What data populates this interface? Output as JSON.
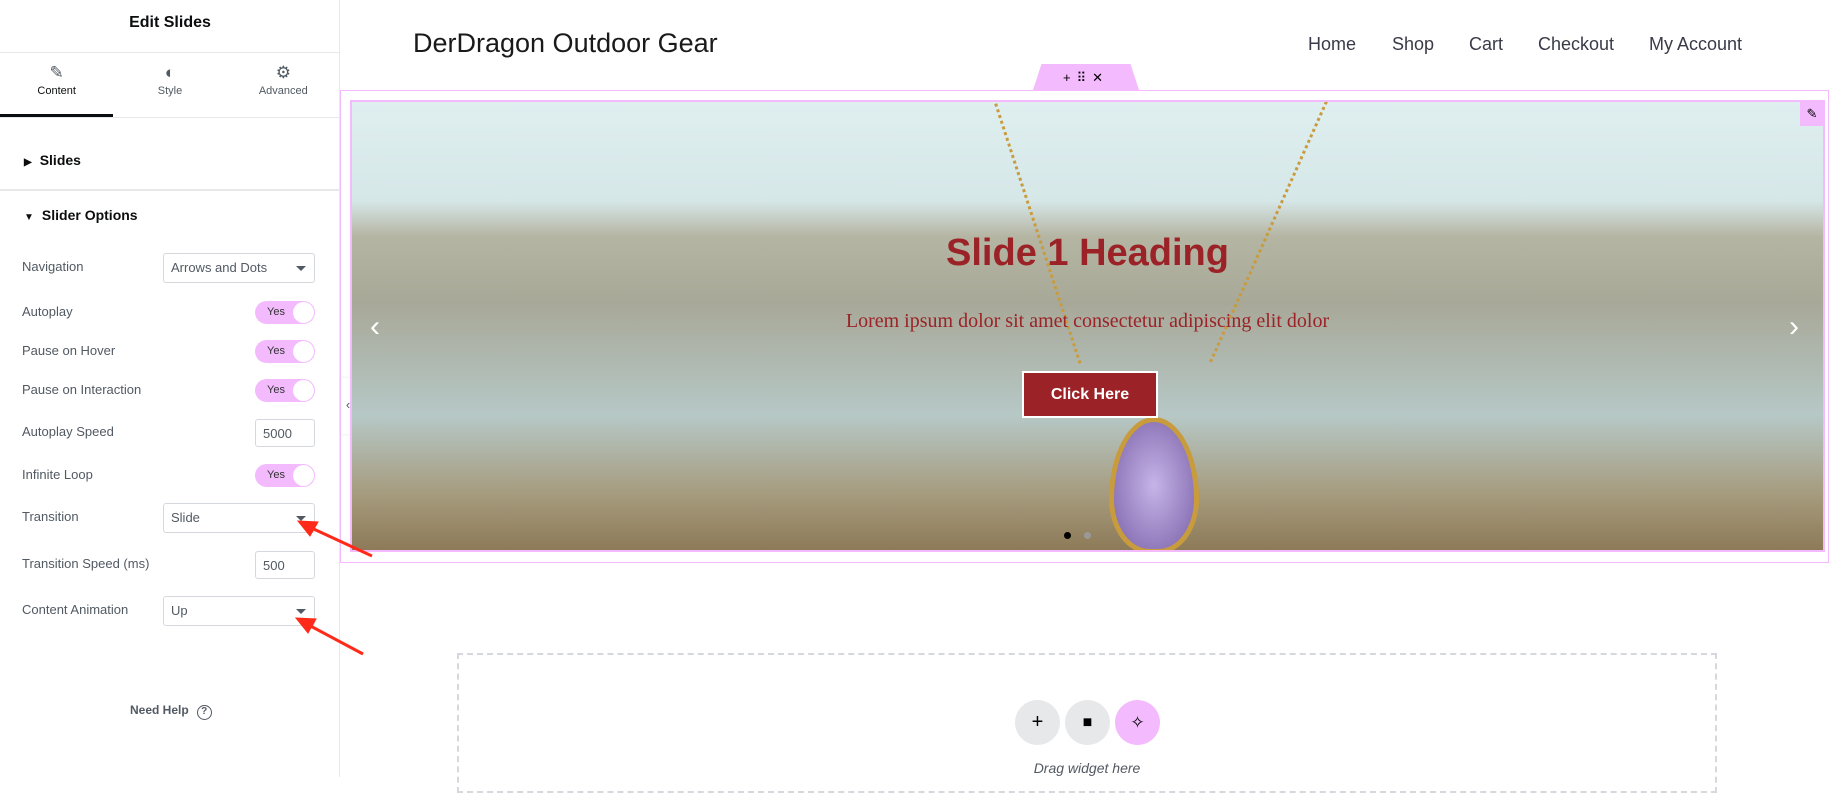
{
  "panel": {
    "title": "Edit Slides",
    "tabs": [
      {
        "label": "Content",
        "icon": "pencil-icon"
      },
      {
        "label": "Style",
        "icon": "contrast-icon"
      },
      {
        "label": "Advanced",
        "icon": "gear-icon"
      }
    ],
    "sections": {
      "slides": "Slides",
      "slider_options": "Slider Options"
    },
    "controls": {
      "navigation": {
        "label": "Navigation",
        "value": "Arrows and Dots"
      },
      "autoplay": {
        "label": "Autoplay",
        "value": "Yes"
      },
      "pause_hover": {
        "label": "Pause on Hover",
        "value": "Yes"
      },
      "pause_interaction": {
        "label": "Pause on Interaction",
        "value": "Yes"
      },
      "autoplay_speed": {
        "label": "Autoplay Speed",
        "value": "5000"
      },
      "infinite_loop": {
        "label": "Infinite Loop",
        "value": "Yes"
      },
      "transition": {
        "label": "Transition",
        "value": "Slide"
      },
      "transition_speed": {
        "label": "Transition Speed (ms)",
        "value": "500"
      },
      "content_animation": {
        "label": "Content Animation",
        "value": "Up"
      }
    },
    "help": "Need Help"
  },
  "site": {
    "logo": "DerDragon Outdoor Gear",
    "nav": [
      "Home",
      "Shop",
      "Cart",
      "Checkout",
      "My Account"
    ]
  },
  "slide": {
    "heading": "Slide 1 Heading",
    "text": "Lorem ipsum dolor sit amet consectetur adipiscing elit dolor",
    "button": "Click Here"
  },
  "dropzone": {
    "text": "Drag widget here"
  },
  "colors": {
    "accent": "#f3bafd",
    "slide_text": "#9b2226",
    "annotation_arrow": "#ff2a1a"
  }
}
